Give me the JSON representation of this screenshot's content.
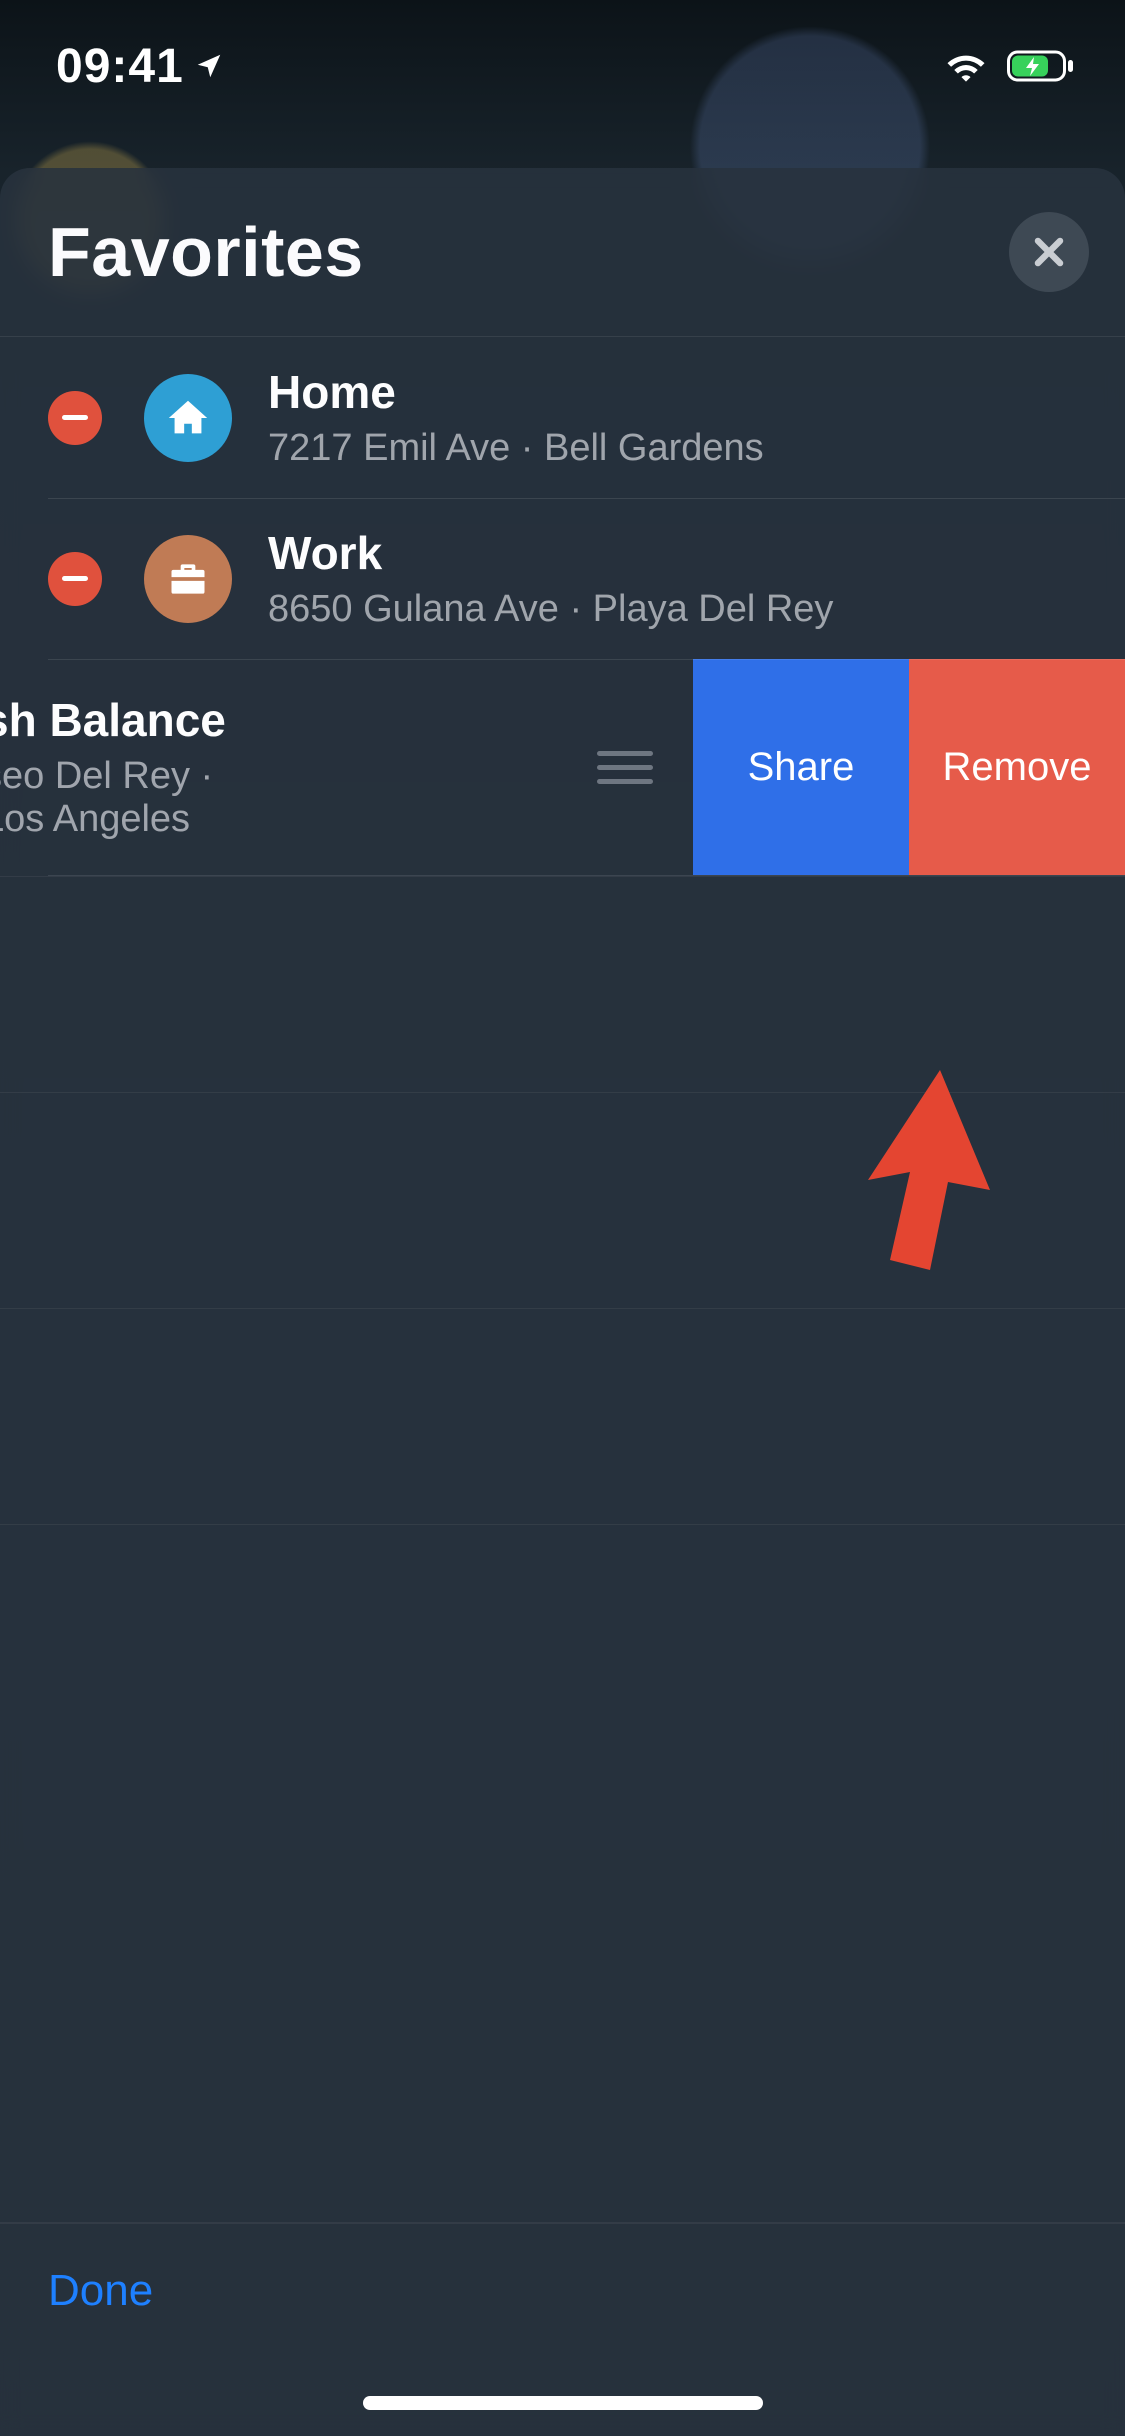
{
  "statusbar": {
    "time": "09:41"
  },
  "sheet": {
    "title": "Favorites",
    "done_label": "Done"
  },
  "favorites": [
    {
      "name": "Home",
      "address": "7217 Emil Ave · Bell Gardens",
      "icon": "home",
      "icon_bg": "#2e9fd4"
    },
    {
      "name": "Work",
      "address": "8650 Gulana Ave · Playa Del Rey",
      "icon": "briefcase",
      "icon_bg": "#c07b55"
    },
    {
      "name": "sh Balance",
      "address": "seo Del Rey · Los Angeles",
      "icon": "pin",
      "icon_bg": "#c9504e",
      "swiped": true
    }
  ],
  "swipe_actions": {
    "share_label": "Share",
    "remove_label": "Remove"
  },
  "colors": {
    "share_bg": "#2f6fe8",
    "remove_bg": "#e65b4a",
    "delete_badge": "#e0513d",
    "accent_blue": "#1e80ff"
  }
}
